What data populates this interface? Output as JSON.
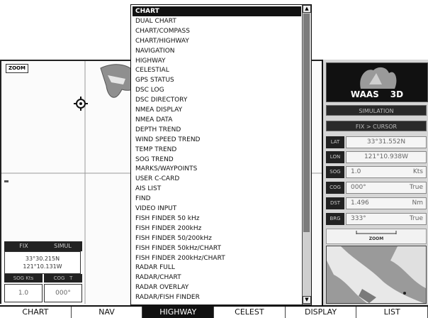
{
  "menu": {
    "items": [
      {
        "label": "CHART",
        "selected": true
      },
      {
        "label": "DUAL CHART"
      },
      {
        "label": "CHART/COMPASS"
      },
      {
        "label": "CHART/HIGHWAY"
      },
      {
        "label": "NAVIGATION"
      },
      {
        "label": "HIGHWAY"
      },
      {
        "label": "CELESTIAL"
      },
      {
        "label": "GPS STATUS"
      },
      {
        "label": "DSC LOG"
      },
      {
        "label": "DSC DIRECTORY"
      },
      {
        "label": "NMEA DISPLAY"
      },
      {
        "label": "NMEA DATA"
      },
      {
        "label": "DEPTH TREND"
      },
      {
        "label": "WIND SPEED TREND"
      },
      {
        "label": "TEMP TREND"
      },
      {
        "label": "SOG TREND"
      },
      {
        "label": "MARKS/WAYPOINTS"
      },
      {
        "label": "USER C-CARD"
      },
      {
        "label": "AIS LIST"
      },
      {
        "label": "FIND"
      },
      {
        "label": "VIDEO INPUT"
      },
      {
        "label": "FISH FINDER 50 kHz"
      },
      {
        "label": "FISH FINDER 200kHz"
      },
      {
        "label": "FISH FINDER 50/200kHz"
      },
      {
        "label": "FISH FINDER 50kHz/CHART"
      },
      {
        "label": "FISH FINDER 200kHz/CHART"
      },
      {
        "label": "RADAR FULL"
      },
      {
        "label": "RADAR/CHART"
      },
      {
        "label": "RADAR OVERLAY"
      },
      {
        "label": "RADAR/FISH FINDER"
      }
    ]
  },
  "map": {
    "zoom_badge": "ZOOM",
    "fix_header": "FIX",
    "simul_header": "SIMUL",
    "fix_lat": "33°30.215N",
    "fix_lon": "121°10.131W",
    "sog_label": "SOG Kts",
    "cog_label": "COG",
    "cog_unit": "T",
    "sog_value": "1.0",
    "cog_value": "000°"
  },
  "panel": {
    "waas": "WAAS",
    "fix_type": "3D",
    "simulation": "SIMULATION",
    "fix_cursor": "FIX > CURSOR",
    "rows": [
      {
        "label": "LAT",
        "value": "33°31.552N",
        "unit": ""
      },
      {
        "label": "LON",
        "value": "121°10.938W",
        "unit": ""
      },
      {
        "label": "SOG",
        "value": "1.0",
        "unit": "Kts"
      },
      {
        "label": "COG",
        "value": "000°",
        "unit": "True"
      },
      {
        "label": "DST",
        "value": "1.496",
        "unit": "Nm"
      },
      {
        "label": "BRG",
        "value": "333°",
        "unit": "True"
      }
    ],
    "scale_label": "ZOOM"
  },
  "tabs": [
    {
      "label": "CHART"
    },
    {
      "label": "NAV"
    },
    {
      "label": "HIGHWAY",
      "active": true
    },
    {
      "label": "CELEST"
    },
    {
      "label": "DISPLAY"
    },
    {
      "label": "LIST"
    }
  ]
}
